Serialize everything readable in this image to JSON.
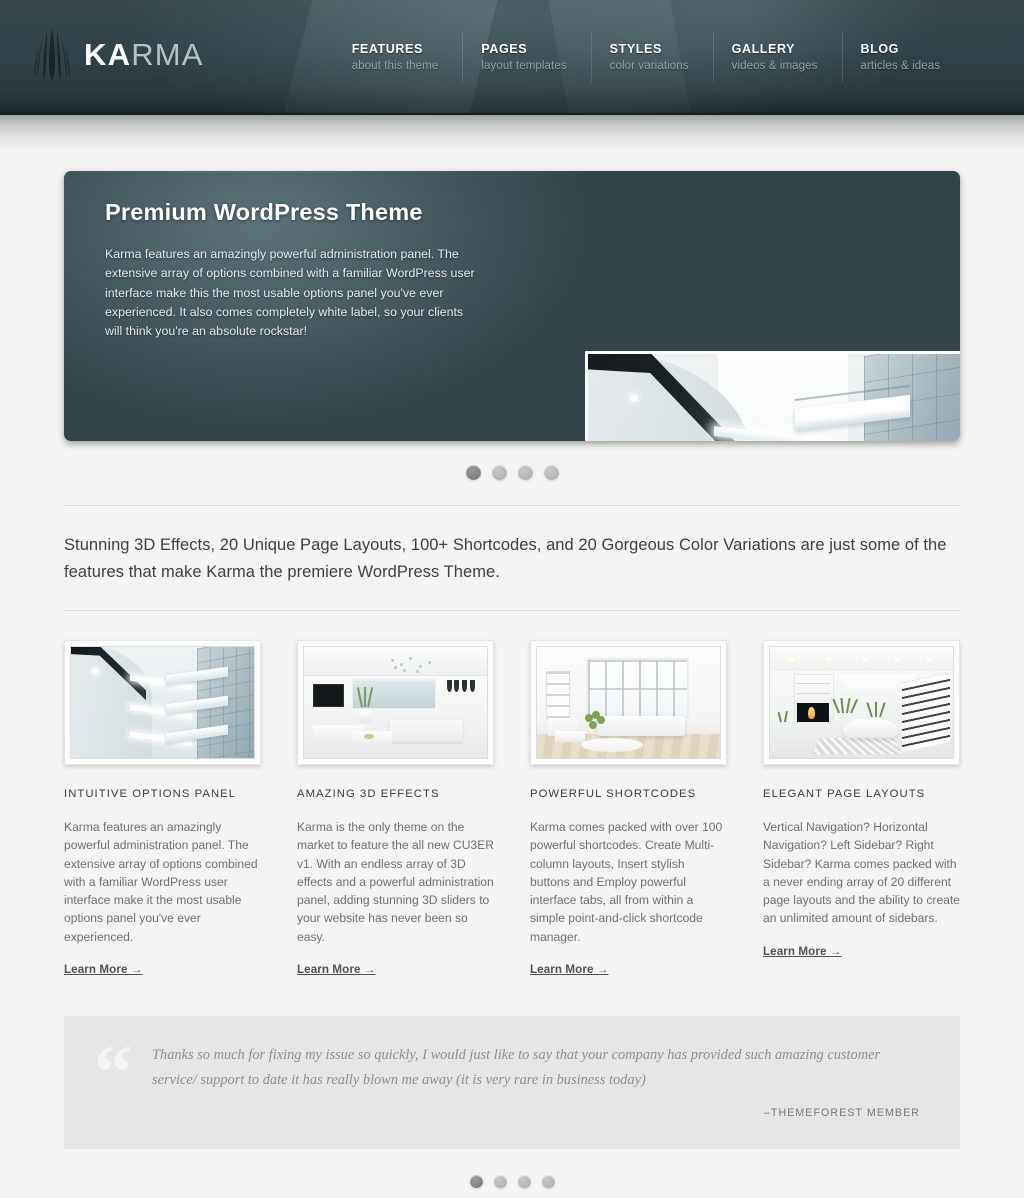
{
  "header": {
    "logo": {
      "bold_part": "KA",
      "light_part": "RMA",
      "icon": "karma-leaf-logo"
    },
    "nav": [
      {
        "title": "FEATURES",
        "subtitle": "about this theme"
      },
      {
        "title": "PAGES",
        "subtitle": "layout templates"
      },
      {
        "title": "STYLES",
        "subtitle": "color variations"
      },
      {
        "title": "GALLERY",
        "subtitle": "videos & images"
      },
      {
        "title": "BLOG",
        "subtitle": "articles & ideas"
      }
    ]
  },
  "slider": {
    "title": "Premium WordPress Theme",
    "description": "Karma features an amazingly powerful administration panel. The extensive array of options combined with a familiar WordPress user interface make this the most usable options panel you've ever experienced. It also comes completely white label, so your clients will think you're an absolute rockstar!",
    "image_alt": "modern-atrium-architecture-photo",
    "pager": {
      "count": 4,
      "active_index": 0
    }
  },
  "intro": {
    "text": "Stunning 3D Effects, 20 Unique Page Layouts, 100+ Shortcodes, and 20 Gorgeous Color Variations are just some of the features that make Karma the premiere WordPress Theme."
  },
  "features": [
    {
      "title": "INTUITIVE OPTIONS PANEL",
      "body": "Karma features an amazingly powerful administration panel. The extensive array of options combined with a familiar WordPress user interface make it the most usable options panel you've ever experienced.",
      "link": "Learn More →",
      "image_alt": "atrium-architecture-thumbnail"
    },
    {
      "title": "AMAZING 3D EFFECTS",
      "body": "Karma is the only theme on the market to feature the all new CU3ER v1. With an endless array of 3D effects and a powerful administration panel, adding stunning 3D sliders to your website has never been so easy.",
      "link": "Learn More →",
      "image_alt": "white-living-room-sea-view-thumbnail"
    },
    {
      "title": "POWERFUL SHORTCODES",
      "body": "Karma comes packed with over 100 powerful shortcodes. Create Multi-column layouts, Insert stylish buttons and Employ powerful interface tabs, all from within a simple point-and-click shortcode manager.",
      "link": "Learn More →",
      "image_alt": "white-lounge-big-windows-thumbnail"
    },
    {
      "title": "ELEGANT PAGE LAYOUTS",
      "body": "Vertical Navigation? Horizontal Navigation? Left Sidebar? Right Sidebar? Karma comes packed with a never ending array of 20 different page layouts and the ability to create an unlimited amount of sidebars.",
      "link": "Learn More →",
      "image_alt": "fireplace-staircase-interior-thumbnail"
    }
  ],
  "testimonial": {
    "quote_glyph": "“",
    "text": "Thanks so much for fixing my issue so quickly, I would just like to say that your company has provided such amazing customer service/ support to date it has really blown me away (it is very rare in business today)",
    "author": "–THEMEFOREST MEMBER",
    "pager": {
      "count": 4,
      "active_index": 0
    }
  },
  "colors": {
    "header_dark": "#31434a",
    "header_bottom": "#1d282c",
    "page_bg": "#f4f4f2",
    "slider_bg": "#44575e",
    "body_text": "#6d7174",
    "heading_text": "#3b3d3f",
    "testimonial_bg": "#e6e6e4",
    "pager_active": "#848484",
    "pager_inactive": "#b8b8b8"
  }
}
